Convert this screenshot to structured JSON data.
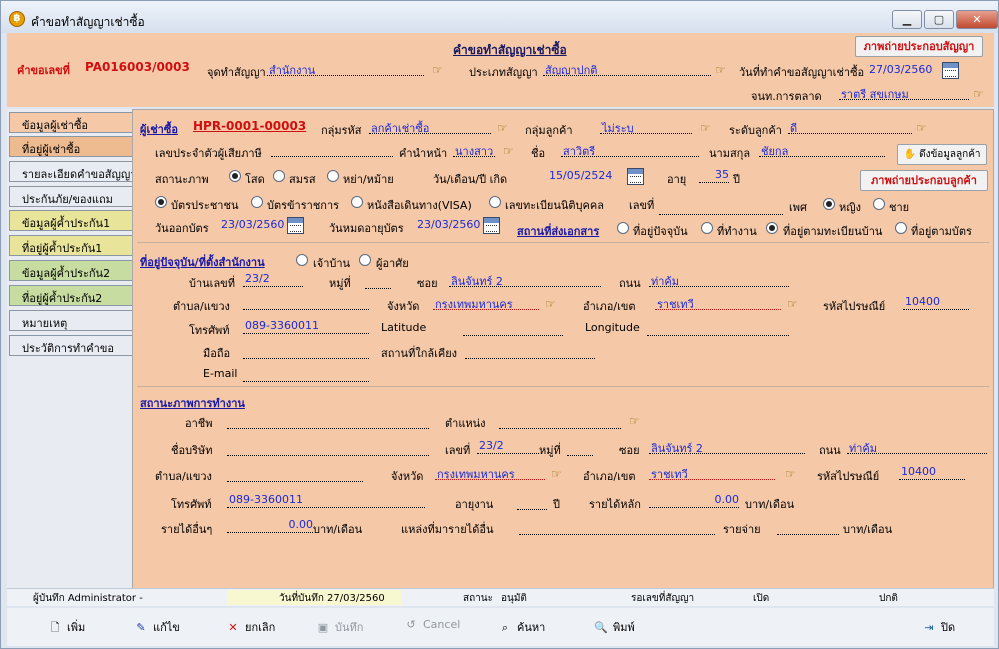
{
  "window": {
    "title": "คำขอทำสัญญาเช่าซื้อ",
    "min": "▁",
    "max": "▢",
    "close": "✕"
  },
  "header": {
    "form_title": "คำขอทำสัญญาเช่าซื้อ",
    "photo_contract_button": "ภาพถ่ายประกอบสัญญา",
    "request_no_label": "คำขอเลขที่",
    "request_no": "PA016003/0003",
    "place_label": "จุดทำสัญญา",
    "place_value": "สำนักงาน",
    "contract_type_label": "ประเภทสัญญา",
    "contract_type_value": "สัญญาปกติ",
    "request_date_label": "วันที่ทำคำขอสัญญาเช่าซื้อ",
    "request_date_value": "27/03/2560",
    "marketing_label": "จนท.การตลาด",
    "marketing_value": "ราตรี สุขเกษม"
  },
  "sidebar": {
    "items": [
      {
        "label": "ข้อมูลผู้เช่าซื้อ",
        "color": "#f5c8a8"
      },
      {
        "label": "ที่อยู่ผู้เช่าซื้อ",
        "color": "#eebb90"
      },
      {
        "label": "รายละเอียดคำขอสัญญา",
        "color": "#e8ecf2"
      },
      {
        "label": "ประกันภัย/ของแถม",
        "color": "#e8ecf2"
      },
      {
        "label": "ข้อมูลผู้ค้ำประกัน1",
        "color": "#e8e49a"
      },
      {
        "label": "ที่อยู่ผู้ค้ำประกัน1",
        "color": "#e8e49a"
      },
      {
        "label": "ข้อมูลผู้ค้ำประกัน2",
        "color": "#c6dca0"
      },
      {
        "label": "ที่อยู่ผู้ค้ำประกัน2",
        "color": "#c6dca0"
      },
      {
        "label": "หมายเหตุ",
        "color": "#e8ecf2"
      },
      {
        "label": "ประวัติการทำคำขอ",
        "color": "#e8ecf2"
      }
    ]
  },
  "customer": {
    "buyer_link": "ผู้เช่าซื้อ",
    "buyer_code": "HPR-0001-00003",
    "group_code_label": "กลุ่มรหัส",
    "group_code_value": "ลูกค้าเช่าซื้อ",
    "customer_group_label": "กลุ่มลูกค้า",
    "customer_group_value": "ไม่ระบุ",
    "level_label": "ระดับลูกค้า",
    "level_value": "ดี",
    "taxid_label": "เลขประจำตัวผู้เสียภาษี",
    "taxid_value": "",
    "prefix_label": "คำนำหน้า",
    "prefix_value": "นางสาว",
    "name_label": "ชื่อ",
    "name_value": "สาวิตรี",
    "surname_label": "นามสกุล",
    "surname_value": "ชัยกุล",
    "pull_button": "ดึงข้อมูลลูกค้า",
    "marital_label": "สถานะภาพ",
    "marital_options": [
      "โสด",
      "สมรส",
      "หย่า/หม้าย"
    ],
    "birth_label": "วัน/เดือน/ปี เกิด",
    "birth_value": "15/05/2524",
    "age_label": "อายุ",
    "age_value": "35",
    "age_unit": "ปี",
    "photo_customer_button": "ภาพถ่ายประกอบลูกค้า",
    "card_options": [
      "บัตรประชาชน",
      "บัตรข้าราชการ",
      "หนังสือเดินทาง(VISA)",
      "เลขทะเบียนนิติบุคคล"
    ],
    "card_no_label": "เลขที่",
    "card_no_value": "",
    "gender_label": "เพศ",
    "gender_options": [
      "หญิง",
      "ชาย"
    ],
    "issue_label": "วันออกบัตร",
    "issue_value": "23/03/2560",
    "expire_label": "วันหมดอายุบัตร",
    "expire_value": "23/03/2560",
    "doc_addr_link": "สถานที่ส่งเอกสาร",
    "doc_addr_options": [
      "ที่อยู่ปัจจุบัน",
      "ที่ทำงาน",
      "ที่อยู่ตามทะเบียนบ้าน",
      "ที่อยู่ตามบัตร"
    ]
  },
  "address": {
    "section_link": "ที่อยู่ปัจจุบัน/ที่ตั้งสำนักงาน",
    "owner_options": [
      "เจ้าบ้าน",
      "ผู้อาศัย"
    ],
    "house_no_label": "บ้านเลขที่",
    "house_no_value": "23/2",
    "moo_label": "หมู่ที่",
    "moo_value": "",
    "soi_label": "ซอย",
    "soi_value": "ลินจันทร์ 2",
    "road_label": "ถนน",
    "road_value": "ท่าคุ้ม",
    "subdistrict_label": "ตำบล/แขวง",
    "subdistrict_value": "",
    "province_label": "จังหวัด",
    "province_value": "กรุงเทพมหานคร",
    "district_label": "อำเภอ/เขต",
    "district_value": "ราชเทวี",
    "postcode_label": "รหัสไปรษณีย์",
    "postcode_value": "10400",
    "phone_label": "โทรศัพท์",
    "phone_value": "089-3360011",
    "lat_label": "Latitude",
    "lat_value": "",
    "long_label": "Longitude",
    "long_value": "",
    "mobile_label": "มือถือ",
    "mobile_value": "",
    "nearby_label": "สถานที่ใกล้เคียง",
    "nearby_value": "",
    "email_label": "E-mail",
    "email_value": ""
  },
  "work": {
    "section_link": "สถานะภาพการทำงาน",
    "career_label": "อาชีพ",
    "career_value": "",
    "position_label": "ตำแหน่ง",
    "position_value": "",
    "company_label": "ชื่อบริษัท",
    "company_value": "",
    "no_label": "เลขที่",
    "no_value": "23/2",
    "moo_label": "หมู่ที่",
    "moo_value": "",
    "soi_label": "ซอย",
    "soi_value": "ลินจันทร์ 2",
    "road_label": "ถนน",
    "road_value": "ท่าคุ้ม",
    "subdistrict_label": "ตำบล/แขวง",
    "subdistrict_value": "",
    "province_label": "จังหวัด",
    "province_value": "กรุงเทพมหานคร",
    "district_label": "อำเภอ/เขต",
    "district_value": "ราชเทวี",
    "postcode_label": "รหัสไปรษณีย์",
    "postcode_value": "10400",
    "phone_label": "โทรศัพท์",
    "phone_value": "089-3360011",
    "worktime_label": "อายุงาน",
    "worktime_value": "",
    "worktime_unit": "ปี",
    "income_label": "รายได้หลัก",
    "income_value": "0.00",
    "income_unit": "บาท/เดือน",
    "other_income_label": "รายได้อื่นๆ",
    "other_income_value": "0.00",
    "other_income_unit": "บาท/เดือน",
    "other_source_label": "แหล่งที่มารายได้อื่น",
    "other_source_value": "",
    "expense_label": "รายจ่าย",
    "expense_value": "",
    "expense_unit": "บาท/เดือน"
  },
  "status": {
    "recorder": "ผู้บันทึก Administrator -",
    "record_date": "วันที่บันทึก 27/03/2560",
    "state_label": "สถานะ",
    "state_value": "อนุมัติ",
    "wait_label": "รอเลขที่สัญญา",
    "open": "เปิด",
    "normal": "ปกติ"
  },
  "toolbar": {
    "add": "เพิ่ม",
    "edit": "แก้ไข",
    "cancel_edit": "ยกเลิก",
    "save": "บันทึก",
    "cancel": "Cancel",
    "search": "ค้นหา",
    "print": "พิมพ์",
    "close": "ปิด"
  }
}
